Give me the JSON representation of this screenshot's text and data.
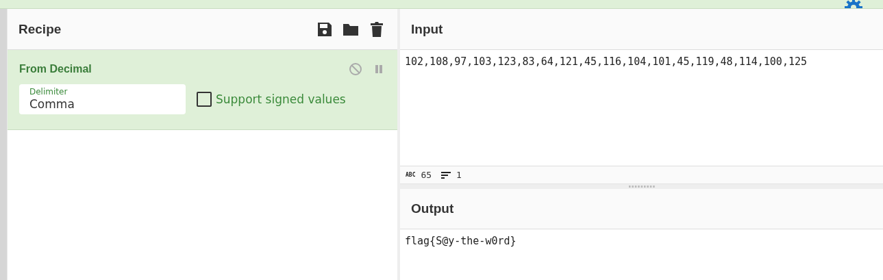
{
  "recipe": {
    "title": "Recipe",
    "operations": [
      {
        "name": "From Decimal",
        "disabled": false,
        "breakpoint": false,
        "delimiter": {
          "label": "Delimiter",
          "value": "Comma"
        },
        "option": {
          "label": "Support signed values",
          "checked": false
        }
      }
    ]
  },
  "input": {
    "title": "Input",
    "value": "102,108,97,103,123,83,64,121,45,116,104,101,45,119,48,114,100,125",
    "stats": [
      {
        "kind": "length",
        "label": "ABC",
        "value": "65"
      },
      {
        "kind": "lines",
        "value": "1"
      }
    ]
  },
  "output": {
    "title": "Output",
    "value": "flag{S@y-the-w0rd}"
  }
}
